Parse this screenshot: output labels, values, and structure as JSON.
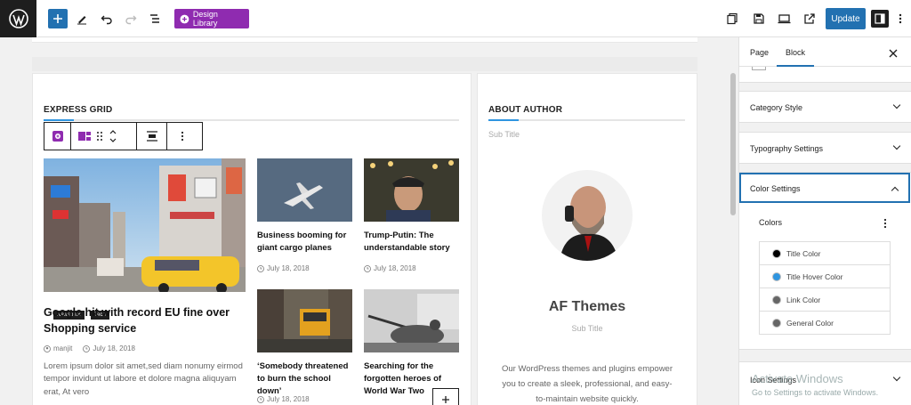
{
  "topbar": {
    "design_library_label": "Design Library",
    "update_label": "Update",
    "icons": [
      "wordpress-logo",
      "plus-icon",
      "pencil-icon",
      "undo-icon",
      "redo-icon",
      "list-view-icon",
      "preview-devices-icon",
      "save-icon",
      "desktop-icon",
      "external-link-icon",
      "settings-panel-icon",
      "more-icon"
    ]
  },
  "express_grid": {
    "title": "EXPRESS GRID",
    "featured": {
      "categories": [
        "Newsbeat",
        "Tech"
      ],
      "title": "Google hit with record EU fine over Shopping service",
      "author": "manjit",
      "date": "July 18, 2018",
      "excerpt": "Lorem ipsum dolor sit amet,sed diam nonumy eirmod tempor invidunt ut labore et dolore magna aliquyam erat, At vero"
    },
    "posts": [
      {
        "title": "Business booming for giant cargo planes",
        "date": "July 18, 2018"
      },
      {
        "title": "Trump-Putin: The understandable story",
        "date": "July 18, 2018"
      },
      {
        "title": "‘Somebody threatened to burn the school down’",
        "date": "July 18, 2018"
      },
      {
        "title": "Searching for the forgotten heroes of World War Two",
        "date": ""
      }
    ]
  },
  "about_author": {
    "title": "ABOUT AUTHOR",
    "subtitle": "Sub Title",
    "name": "AF Themes",
    "name_subtitle": "Sub Title",
    "description": "Our WordPress themes and plugins empower you to create a sleek, professional, and easy-to-maintain website quickly."
  },
  "sidebar": {
    "tabs": [
      "Page",
      "Block"
    ],
    "active_tab": "Block",
    "panels": [
      {
        "label": "Category Style",
        "open": false
      },
      {
        "label": "Typography Settings",
        "open": false
      },
      {
        "label": "Color Settings",
        "open": true
      },
      {
        "label": "Icon Settings",
        "open": false
      }
    ],
    "colors_heading": "Colors",
    "color_items": [
      {
        "label": "Title Color",
        "color": "#000000"
      },
      {
        "label": "Title Hover Color",
        "color": "#2f95e0"
      },
      {
        "label": "Link Color",
        "color": "#666666"
      },
      {
        "label": "General Color",
        "color": "#666666"
      }
    ]
  },
  "watermark": {
    "line1": "Activate Windows",
    "line2": "Go to Settings to activate Windows."
  }
}
